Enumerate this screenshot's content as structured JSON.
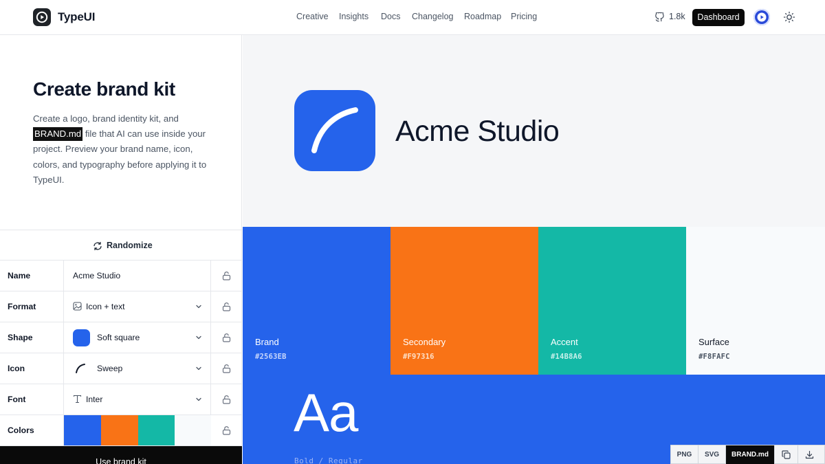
{
  "header": {
    "brand": "TypeUI",
    "nav": [
      "Creative",
      "Insights",
      "Docs",
      "Changelog",
      "Roadmap",
      "Pricing"
    ],
    "github_stars": "1.8k",
    "dashboard_label": "Dashboard"
  },
  "intro": {
    "title": "Create brand kit",
    "desc_before": "Create a logo, brand identity kit, and ",
    "desc_code": "BRAND.md",
    "desc_after": " file that AI can use inside your project. Preview your brand name, icon, colors, and typography before applying it to TypeUI."
  },
  "randomize_label": "Randomize",
  "settings": {
    "name": {
      "label": "Name",
      "value": "Acme Studio"
    },
    "format": {
      "label": "Format",
      "value": "Icon + text",
      "icon": "image-icon"
    },
    "shape": {
      "label": "Shape",
      "value": "Soft square"
    },
    "icon": {
      "label": "Icon",
      "value": "Sweep",
      "icon": "sweep-icon"
    },
    "font": {
      "label": "Font",
      "value": "Inter",
      "icon": "type-icon"
    },
    "colors": {
      "label": "Colors"
    }
  },
  "use_button_label": "Use brand kit",
  "preview": {
    "brand_name": "Acme Studio",
    "palette": [
      {
        "name": "Brand",
        "hex": "#2563EB"
      },
      {
        "name": "Secondary",
        "hex": "#F97316"
      },
      {
        "name": "Accent",
        "hex": "#14B8A6"
      },
      {
        "name": "Surface",
        "hex": "#F8FAFC"
      }
    ],
    "type_sample": "Aa",
    "type_weights": "Bold / Regular"
  },
  "export": {
    "png": "PNG",
    "svg": "SVG",
    "brandmd": "BRAND.md"
  }
}
